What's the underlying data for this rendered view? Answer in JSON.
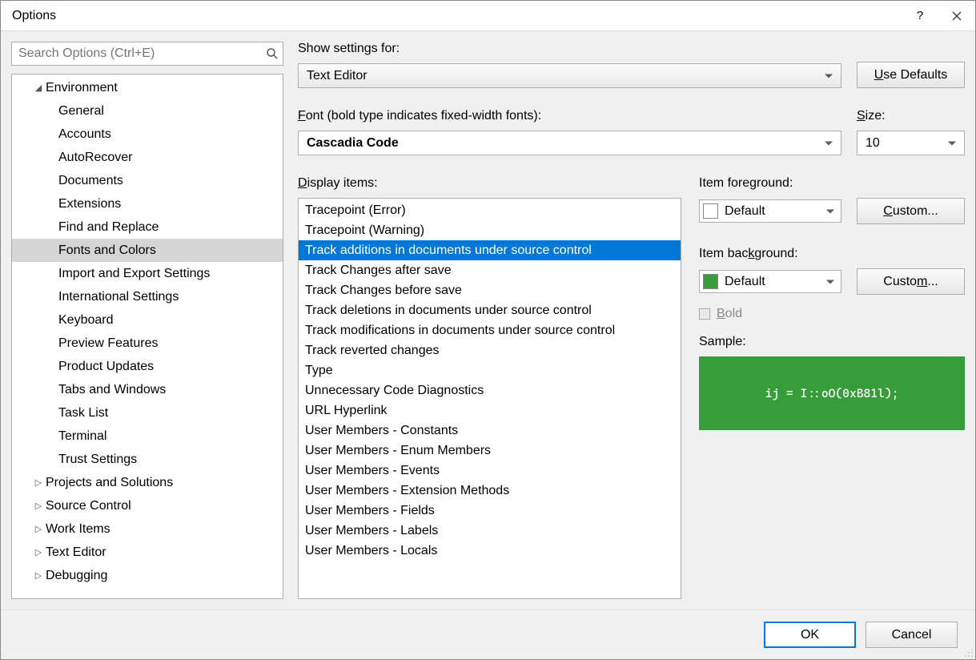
{
  "title": "Options",
  "search_placeholder": "Search Options (Ctrl+E)",
  "tree": {
    "root": [
      {
        "label": "Environment",
        "expanded": true,
        "children": [
          {
            "label": "General"
          },
          {
            "label": "Accounts"
          },
          {
            "label": "AutoRecover"
          },
          {
            "label": "Documents"
          },
          {
            "label": "Extensions"
          },
          {
            "label": "Find and Replace"
          },
          {
            "label": "Fonts and Colors",
            "selected": true
          },
          {
            "label": "Import and Export Settings"
          },
          {
            "label": "International Settings"
          },
          {
            "label": "Keyboard"
          },
          {
            "label": "Preview Features"
          },
          {
            "label": "Product Updates"
          },
          {
            "label": "Tabs and Windows"
          },
          {
            "label": "Task List"
          },
          {
            "label": "Terminal"
          },
          {
            "label": "Trust Settings"
          }
        ]
      },
      {
        "label": "Projects and Solutions",
        "expanded": false
      },
      {
        "label": "Source Control",
        "expanded": false
      },
      {
        "label": "Work Items",
        "expanded": false
      },
      {
        "label": "Text Editor",
        "expanded": false
      },
      {
        "label": "Debugging",
        "expanded": false
      }
    ]
  },
  "labels": {
    "show_settings_for": "Show settings for:",
    "use_defaults": "Use Defaults",
    "font": "Font (bold type indicates fixed-width fonts):",
    "size": "Size:",
    "display_items": "Display items:",
    "item_foreground": "Item foreground:",
    "item_background": "Item background:",
    "custom": "Custom...",
    "bold": "Bold",
    "sample": "Sample:"
  },
  "values": {
    "show_settings_for": "Text Editor",
    "font": "Cascadia Code",
    "size": "10",
    "item_foreground": "Default",
    "item_background": "Default",
    "sample_text": "ij = I::oO(0xB81l);"
  },
  "display_items": [
    "Tracepoint (Error)",
    "Tracepoint (Warning)",
    "Track additions in documents under source control",
    "Track Changes after save",
    "Track Changes before save",
    "Track deletions in documents under source control",
    "Track modifications in documents under source control",
    "Track reverted changes",
    "Type",
    "Unnecessary Code Diagnostics",
    "URL Hyperlink",
    "User Members - Constants",
    "User Members - Enum Members",
    "User Members - Events",
    "User Members - Extension Methods",
    "User Members - Fields",
    "User Members - Labels",
    "User Members - Locals"
  ],
  "display_items_selected_index": 2,
  "footer": {
    "ok": "OK",
    "cancel": "Cancel"
  },
  "colors": {
    "sample_bg": "#379d3a",
    "sample_fg": "#ffffff",
    "selection": "#0078d7"
  }
}
